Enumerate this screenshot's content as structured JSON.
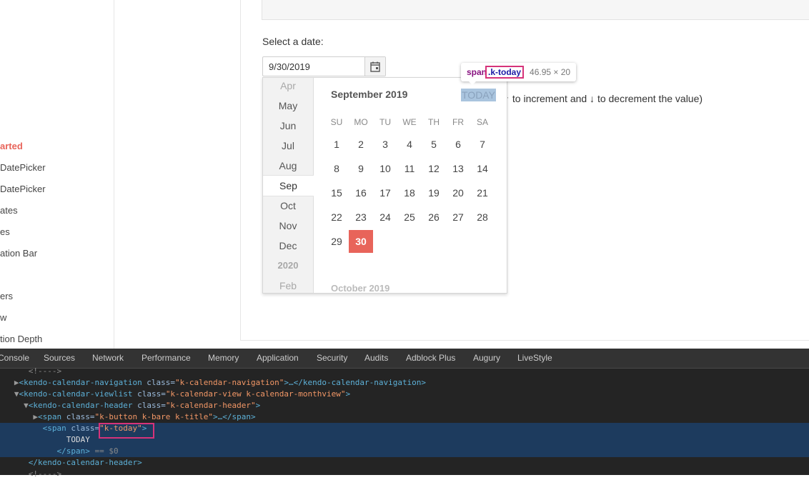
{
  "left_nav": {
    "items": [
      {
        "label": "arted",
        "active": true
      },
      {
        "label": "DatePicker"
      },
      {
        "label": " DatePicker"
      },
      {
        "label": "ates"
      },
      {
        "label": "es"
      },
      {
        "label": "ation Bar"
      },
      {
        "label": "ers"
      },
      {
        "label": "w"
      },
      {
        "label": "tion Depth"
      }
    ]
  },
  "main": {
    "select_label": "Select a date:",
    "date_value": "9/30/2019",
    "hint_text": "↑ to increment and ↓ to decrement the value)"
  },
  "popup": {
    "navigator": [
      {
        "label": "Apr",
        "state": "faded"
      },
      {
        "label": "May"
      },
      {
        "label": "Jun"
      },
      {
        "label": "Jul"
      },
      {
        "label": "Aug"
      },
      {
        "label": "Sep",
        "state": "current"
      },
      {
        "label": "Oct"
      },
      {
        "label": "Nov"
      },
      {
        "label": "Dec"
      },
      {
        "label": "2020",
        "state": "year"
      },
      {
        "label": "Feb",
        "state": "faded"
      }
    ],
    "title": "September 2019",
    "today_label": "TODAY",
    "weekdays": [
      "SU",
      "MO",
      "TU",
      "WE",
      "TH",
      "FR",
      "SA"
    ],
    "weeks": [
      [
        "1",
        "2",
        "3",
        "4",
        "5",
        "6",
        "7"
      ],
      [
        "8",
        "9",
        "10",
        "11",
        "12",
        "13",
        "14"
      ],
      [
        "15",
        "16",
        "17",
        "18",
        "19",
        "20",
        "21"
      ],
      [
        "22",
        "23",
        "24",
        "25",
        "26",
        "27",
        "28"
      ],
      [
        "29",
        "30"
      ]
    ],
    "selected_day": "30",
    "next_month_title": "October 2019"
  },
  "tooltip": {
    "tag": "span",
    "class_name": ".k-today",
    "size": "46.95 × 20"
  },
  "devtools": {
    "tabs": [
      "Console",
      "Sources",
      "Network",
      "Performance",
      "Memory",
      "Application",
      "Security",
      "Audits",
      "Adblock Plus",
      "Augury",
      "LiveStyle"
    ],
    "lines": [
      {
        "indent": "      ",
        "comment": "<!---->"
      },
      {
        "indent": "   ",
        "arrow": "▶",
        "open": "<kendo-calendar-navigation",
        "attr": " class=",
        "val": "\"k-calendar-navigation\"",
        "rest": ">…</kendo-calendar-navigation>"
      },
      {
        "indent": "   ",
        "arrow": "▼",
        "open": "<kendo-calendar-viewlist",
        "attr": " class=",
        "val": "\"k-calendar-view k-calendar-monthview\"",
        "rest": ">"
      },
      {
        "indent": "     ",
        "arrow": "▼",
        "open": "<kendo-calendar-header",
        "attr": " class=",
        "val": "\"k-calendar-header\"",
        "rest": ">"
      },
      {
        "indent": "       ",
        "arrow": "▶",
        "open": "<span",
        "attr": " class=",
        "val": "\"k-button k-bare k-title\"",
        "rest": ">…</span>"
      },
      {
        "indent": "         ",
        "open": "<span",
        "attr": " class=",
        "val": "\"k-today\"",
        "rest": ">",
        "selected": true
      },
      {
        "indent": "              ",
        "text": "TODAY",
        "selected": true
      },
      {
        "indent": "            ",
        "close": "</span>",
        "suffix": " == $0",
        "selected": true
      },
      {
        "indent": "      ",
        "close": "</kendo-calendar-header>"
      },
      {
        "indent": "      ",
        "comment": "<!---->"
      }
    ]
  }
}
